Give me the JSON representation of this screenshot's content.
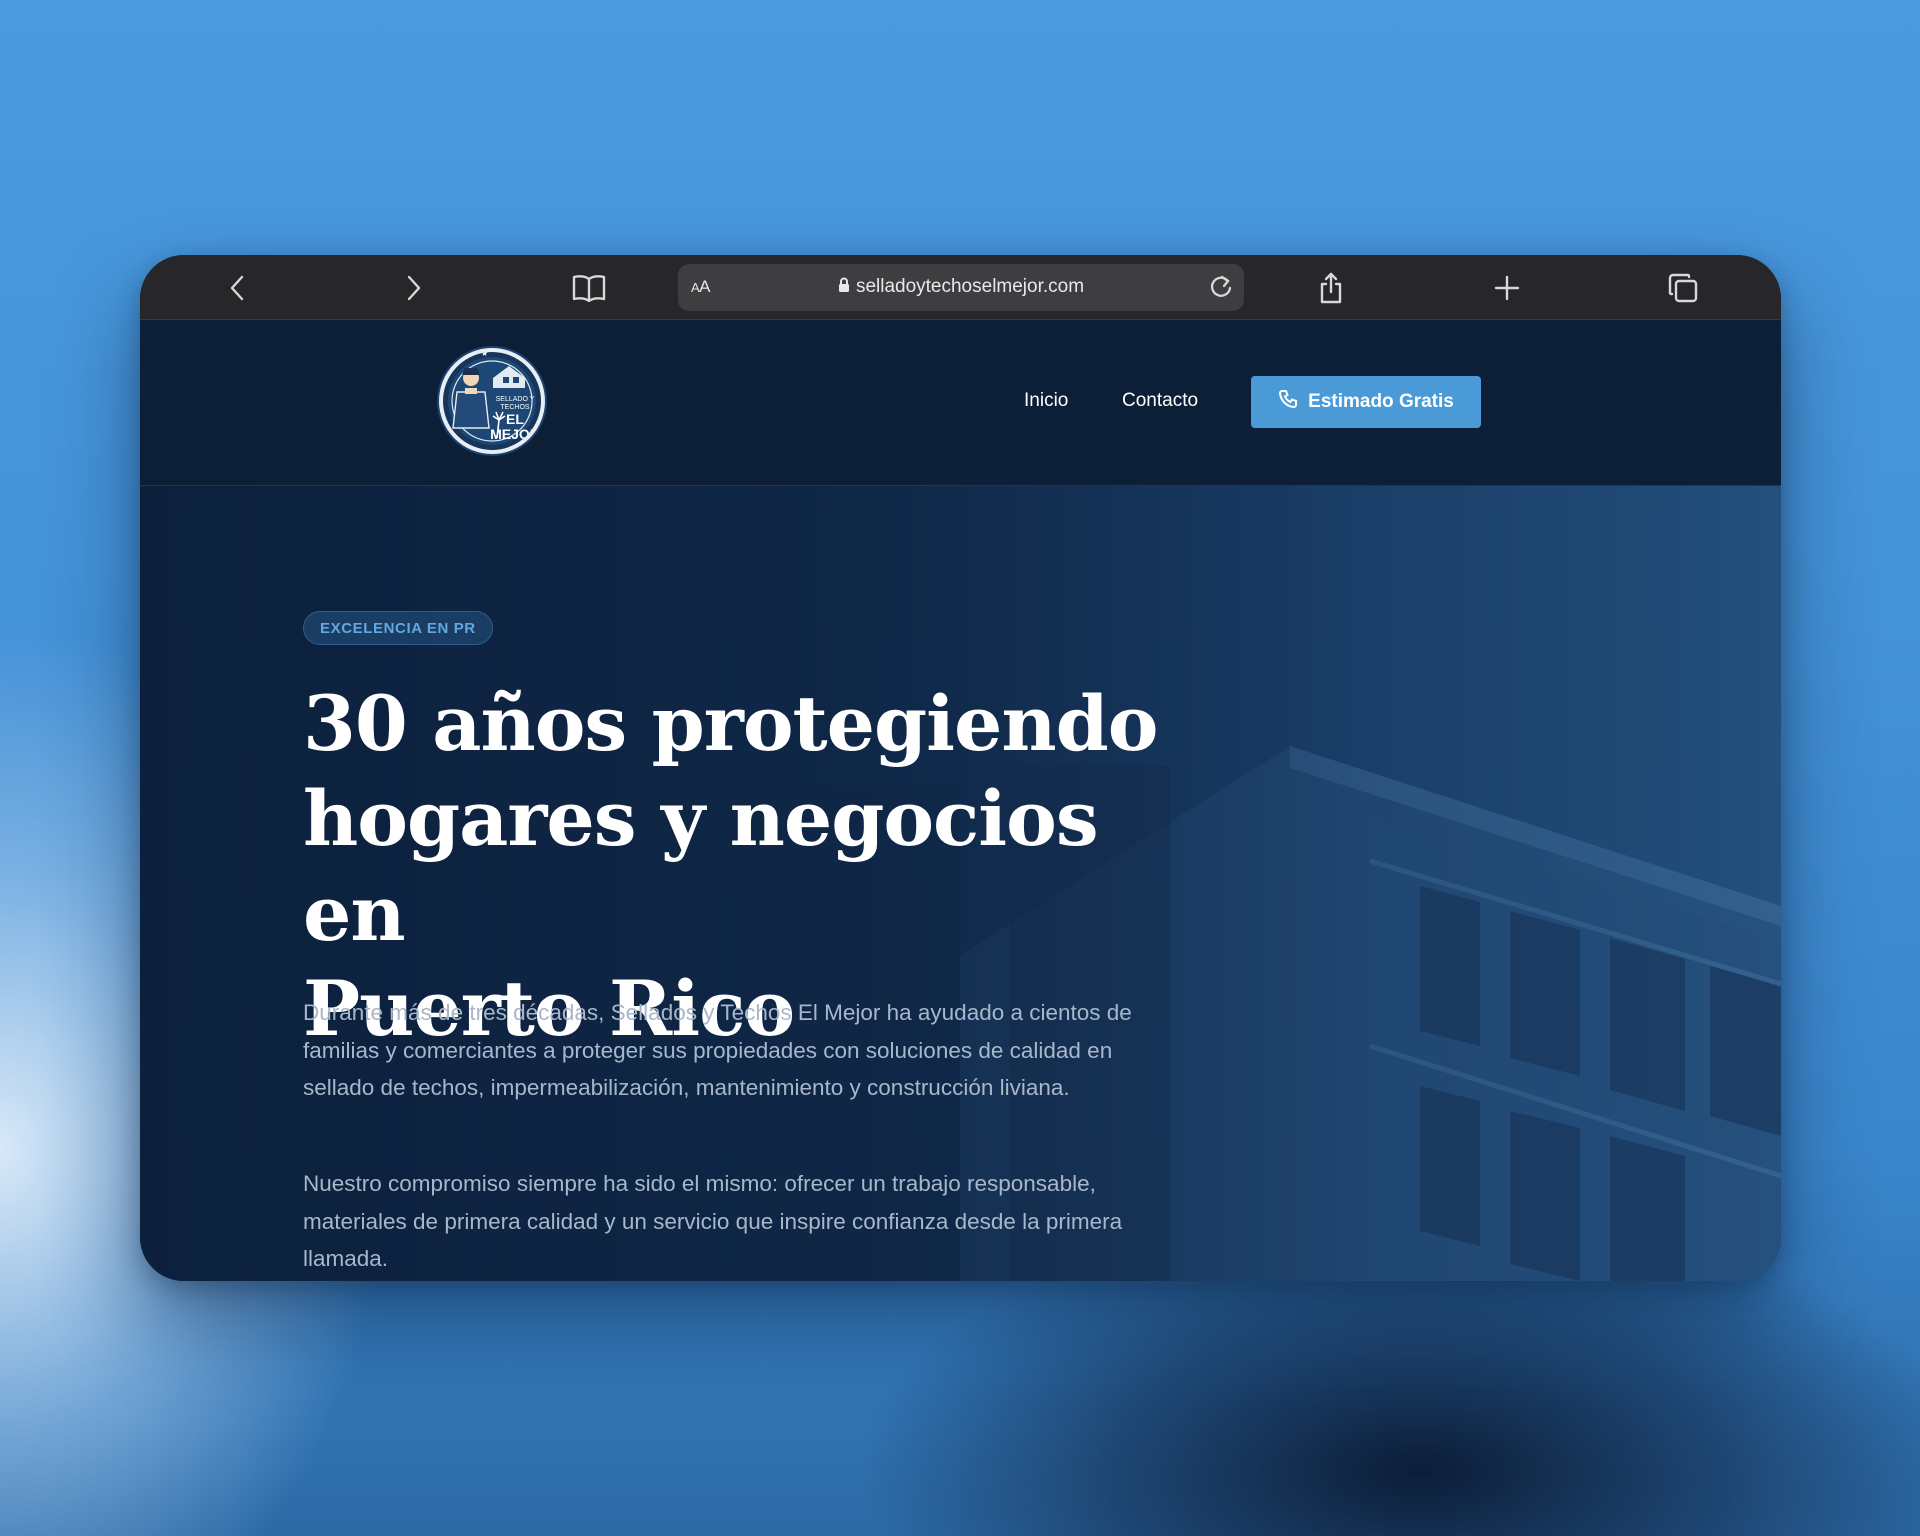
{
  "browser": {
    "reader_label_big": "A",
    "reader_label_small": "A",
    "url": "selladoytechoselmejor.com",
    "icons": [
      "chevron-left-icon",
      "chevron-right-icon",
      "book-icon",
      "lock-icon",
      "reload-icon",
      "share-icon",
      "plus-icon",
      "tabs-icon"
    ]
  },
  "site": {
    "logo": {
      "small_text": "SELLADO Y TECHOS",
      "big_text": "EL MEJOR"
    },
    "nav": [
      {
        "label": "Inicio"
      },
      {
        "label": "Contacto"
      }
    ],
    "cta_label": "Estimado Gratis",
    "hero": {
      "badge": "EXCELENCIA EN PR",
      "title_lines": [
        "30 años protegiendo",
        "hogares y negocios en",
        "Puerto Rico"
      ],
      "paragraph_1": "Durante más de tres décadas, Sellados y Techos El Mejor ha ayudado a cientos de familias y comerciantes a proteger sus propiedades con soluciones de calidad en sellado de techos, impermeabilización, mantenimiento y construcción liviana.",
      "paragraph_2": "Nuestro compromiso siempre ha sido el mismo: ofrecer un trabajo responsable, materiales de primera calidad y un servicio que inspire confianza desde la primera llamada."
    }
  },
  "colors": {
    "accent": "#4b9ad8",
    "header_bg": "#0d1f36",
    "badge_text": "#62a7e0"
  }
}
